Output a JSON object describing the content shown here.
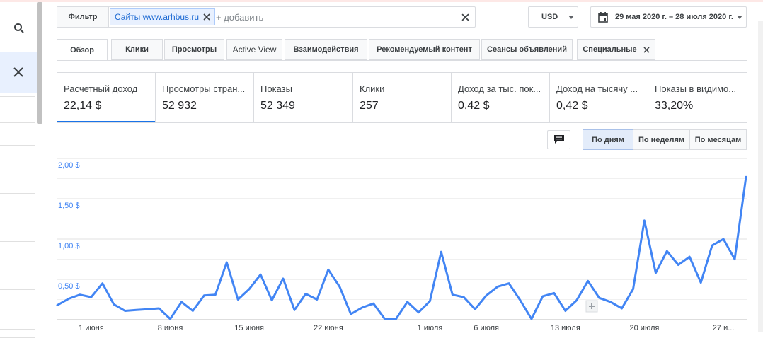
{
  "sidebar": {
    "search_icon": "search-icon",
    "close_icon": "close-icon"
  },
  "filter": {
    "label": "Фильтр",
    "chip": "Сайты www.arhbus.ru",
    "placeholder": "+ добавить"
  },
  "currency": {
    "value": "USD"
  },
  "date_range": {
    "value": "29 мая 2020 г. – 28 июля 2020 г."
  },
  "tabs": [
    {
      "label": "Обзор",
      "active": true
    },
    {
      "label": "Клики"
    },
    {
      "label": "Просмотры"
    },
    {
      "label": "Active View"
    },
    {
      "label": "Взаимодействия"
    },
    {
      "label": "Рекомендуемый контент"
    },
    {
      "label": "Сеансы объявлений"
    },
    {
      "label": "Специальные",
      "closable": true
    }
  ],
  "metrics": [
    {
      "label": "Расчетный доход",
      "value": "22,14 $",
      "selected": true
    },
    {
      "label": "Просмотры стран...",
      "value": "52 932"
    },
    {
      "label": "Показы",
      "value": "52 349"
    },
    {
      "label": "Клики",
      "value": "257"
    },
    {
      "label": "Доход за тыс. пок...",
      "value": "0,42 $"
    },
    {
      "label": "Доход на тысячу ...",
      "value": "0,42 $"
    },
    {
      "label": "Показы в видимо...",
      "value": "33,20%"
    }
  ],
  "period_buttons": [
    {
      "label": "По дням",
      "active": true
    },
    {
      "label": "По неделям"
    },
    {
      "label": "По месяцам"
    }
  ],
  "colors": {
    "accent": "#1a73e8",
    "line": "#4285f4",
    "axis_label": "#4285f4"
  },
  "chart_data": {
    "type": "line",
    "ylim": [
      0,
      2.0
    ],
    "y_ticks": [
      {
        "value": 2.0,
        "label": "2,00 $"
      },
      {
        "value": 1.5,
        "label": "1,50 $"
      },
      {
        "value": 1.0,
        "label": "1,00 $"
      },
      {
        "value": 0.5,
        "label": "0,50 $"
      }
    ],
    "x_ticks": [
      {
        "index": 3,
        "label": "1 июня"
      },
      {
        "index": 10,
        "label": "8 июня"
      },
      {
        "index": 17,
        "label": "15 июня"
      },
      {
        "index": 24,
        "label": "22 июня"
      },
      {
        "index": 33,
        "label": "1 июля"
      },
      {
        "index": 38,
        "label": "6 июля"
      },
      {
        "index": 45,
        "label": "13 июля"
      },
      {
        "index": 52,
        "label": "20 июля"
      },
      {
        "index": 59,
        "label": "27 и..."
      }
    ],
    "series": [
      {
        "values": [
          0.18,
          0.26,
          0.31,
          0.28,
          0.45,
          0.19,
          0.11,
          0.12,
          0.13,
          0.14,
          0.01,
          0.22,
          0.11,
          0.3,
          0.31,
          0.71,
          0.25,
          0.38,
          0.56,
          0.24,
          0.51,
          0.12,
          0.32,
          0.25,
          0.62,
          0.41,
          0.07,
          0.15,
          0.2,
          0.01,
          0.01,
          0.22,
          0.09,
          0.23,
          0.84,
          0.31,
          0.28,
          0.13,
          0.3,
          0.41,
          0.45,
          0.24,
          0.01,
          0.29,
          0.33,
          0.11,
          0.24,
          0.48,
          0.27,
          0.22,
          0.14,
          0.38,
          1.23,
          0.58,
          0.85,
          0.68,
          0.78,
          0.46,
          0.92,
          1.0,
          0.75,
          1.77
        ]
      }
    ]
  }
}
